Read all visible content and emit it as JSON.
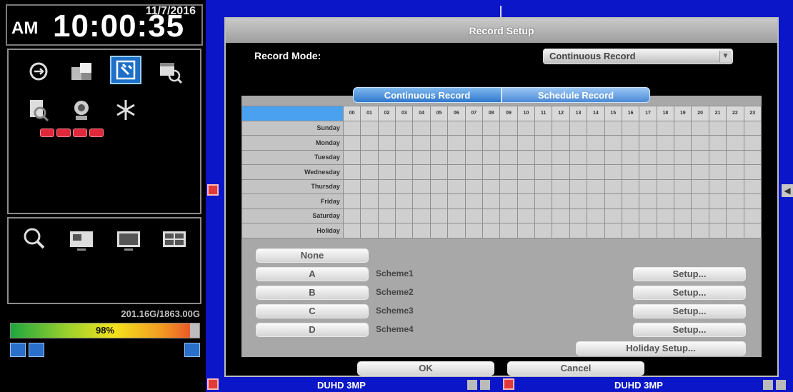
{
  "status": {
    "date": "11/7/2016",
    "ampm": "AM",
    "time": "10:00:35",
    "hdd_usage": "201.16G/1863.00G",
    "hdd_percent": "98%",
    "hdd_fill": 0.95
  },
  "left_icons": [
    "search-playback-icon",
    "folder-icon",
    "record-icon",
    "schedule-search-icon",
    "log-search-icon",
    "ptz-icon",
    "freeze-icon"
  ],
  "view_icons": [
    "zoom-icon",
    "pip-icon",
    "single-view-icon",
    "quad-view-icon"
  ],
  "channels": [
    {
      "label": "DUHD 3MP"
    },
    {
      "label": "DUHD 3MP"
    }
  ],
  "dialog": {
    "title": "Record Setup",
    "record_mode_label": "Record Mode:",
    "record_mode_value": "Continuous Record",
    "tabs": [
      "Continuous Record",
      "Schedule Record"
    ],
    "days": [
      "Sunday",
      "Monday",
      "Tuesday",
      "Wednesday",
      "Thursday",
      "Friday",
      "Saturday",
      "Holiday"
    ],
    "hours": [
      "00",
      "01",
      "02",
      "03",
      "04",
      "05",
      "06",
      "07",
      "08",
      "09",
      "10",
      "11",
      "12",
      "13",
      "14",
      "15",
      "16",
      "17",
      "18",
      "19",
      "20",
      "21",
      "22",
      "23"
    ],
    "none_label": "None",
    "schemes": [
      {
        "button": "A",
        "name": "Scheme1",
        "setup": "Setup..."
      },
      {
        "button": "B",
        "name": "Scheme2",
        "setup": "Setup..."
      },
      {
        "button": "C",
        "name": "Scheme3",
        "setup": "Setup..."
      },
      {
        "button": "D",
        "name": "Scheme4",
        "setup": "Setup..."
      }
    ],
    "holiday_setup": "Holiday Setup...",
    "ok": "OK",
    "cancel": "Cancel"
  }
}
